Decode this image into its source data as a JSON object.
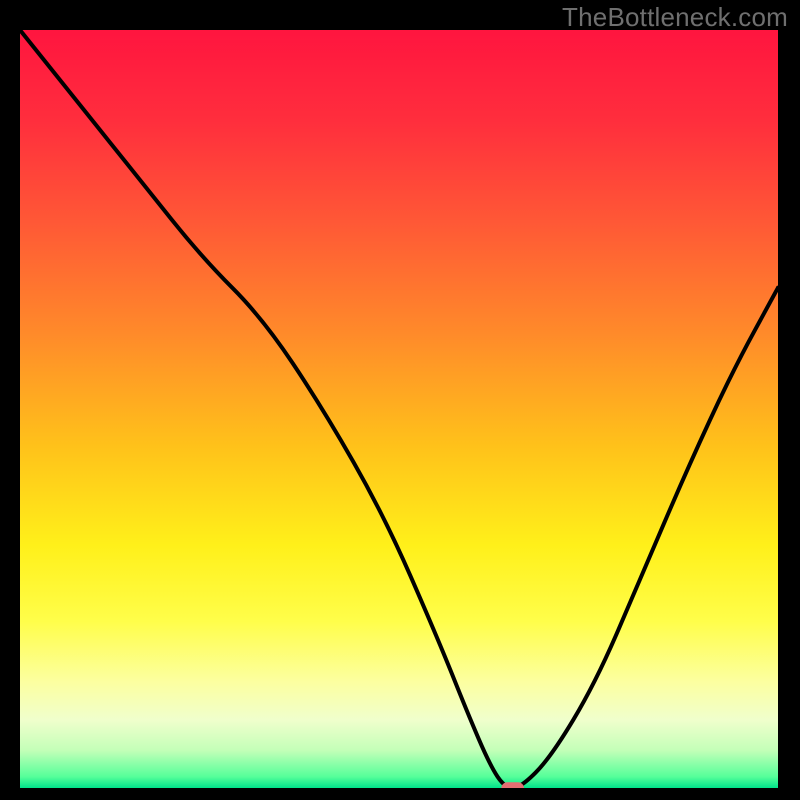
{
  "watermark": "TheBottleneck.com",
  "chart_data": {
    "type": "line",
    "title": "",
    "xlabel": "",
    "ylabel": "",
    "xlim": [
      0,
      100
    ],
    "ylim": [
      0,
      100
    ],
    "grid": false,
    "series": [
      {
        "name": "bottleneck-curve",
        "x": [
          0,
          8,
          16,
          24,
          32,
          40,
          48,
          55,
          59,
          62,
          64,
          66,
          70,
          76,
          82,
          88,
          94,
          100
        ],
        "y": [
          100,
          90,
          80,
          70,
          62,
          50,
          36,
          20,
          10,
          3,
          0,
          0,
          4,
          14,
          28,
          42,
          55,
          66
        ]
      }
    ],
    "marker": {
      "name": "optimal-point",
      "x": 65,
      "y": 0,
      "color": "#e46e72",
      "width": 3,
      "height": 1.5
    },
    "background_gradient": {
      "stops": [
        {
          "offset": 0.0,
          "color": "#ff153f"
        },
        {
          "offset": 0.12,
          "color": "#ff2e3d"
        },
        {
          "offset": 0.25,
          "color": "#ff5736"
        },
        {
          "offset": 0.4,
          "color": "#ff8a2a"
        },
        {
          "offset": 0.55,
          "color": "#ffc21a"
        },
        {
          "offset": 0.68,
          "color": "#fff01a"
        },
        {
          "offset": 0.78,
          "color": "#fffe4a"
        },
        {
          "offset": 0.86,
          "color": "#fcffa0"
        },
        {
          "offset": 0.91,
          "color": "#f0ffcc"
        },
        {
          "offset": 0.95,
          "color": "#c4ffb8"
        },
        {
          "offset": 0.985,
          "color": "#56ff9a"
        },
        {
          "offset": 1.0,
          "color": "#00e28a"
        }
      ]
    }
  }
}
